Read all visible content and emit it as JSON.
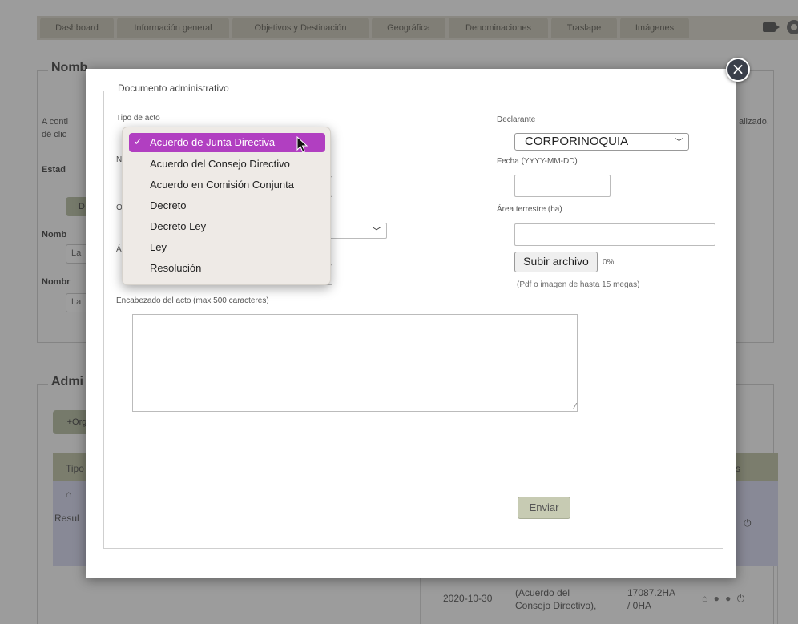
{
  "tabs": [
    "Dashboard",
    "Información general",
    "Objetivos y Destinación",
    "Geográfica",
    "Denominaciones",
    "Traslape",
    "Imágenes"
  ],
  "background": {
    "section1_title": "Nomb",
    "intro_line1": "A conti",
    "intro_line2": "dé clic",
    "intro_right": "alizado,",
    "estado_label": "Estad",
    "btn_d": "D",
    "nombre1_label": "Nomb",
    "nombre1_value": "La",
    "nombre2_label": "Nombr",
    "nombre2_value": "La",
    "section2_title": "Admi",
    "add_button": "+Org",
    "col_tipo": "Tipo",
    "col_right": "s",
    "row_house": "⌂",
    "row_resul": "Resul",
    "row_right_icon": "⏻",
    "bottom_row": {
      "date": "2020-10-30",
      "desc": [
        "(Acuerdo del",
        "Consejo Directivo),"
      ],
      "area": [
        "17087.2HA",
        "/ 0HA"
      ],
      "icons": "⌂ ● ● ⏻"
    }
  },
  "modal": {
    "legend": "Documento administrativo",
    "tipo_acto_label": "Tipo de acto",
    "partial_label_n": "N",
    "partial_label_o": "O",
    "partial_label_a": "Á",
    "declarante_label": "Declarante",
    "declarante_value": "CORPORINOQUIA",
    "fecha_label": "Fecha (YYYY-MM-DD)",
    "fecha_value": "",
    "area_label": "Área terrestre (ha)",
    "area_value": "",
    "upload_button": "Subir archivo",
    "upload_progress": "0%",
    "upload_hint": "(Pdf o imagen de hasta 15 megas)",
    "encabezado_label": "Encabezado del acto (max 500 caracteres)",
    "encabezado_value": "",
    "submit_button": "Enviar",
    "close_icon": "close-icon"
  },
  "tipo_acto_menu": {
    "selected_index": 0,
    "options": [
      "Acuerdo de Junta Directiva",
      "Acuerdo del Consejo Directivo",
      "Acuerdo en Comisión Conjunta",
      "Decreto",
      "Decreto Ley",
      "Ley",
      "Resolución"
    ],
    "check_mark": "✓"
  },
  "colors": {
    "menu_highlight": "#b13fc1",
    "tab_bg": "#c9c5b6",
    "button_green": "#c7cbb3"
  }
}
